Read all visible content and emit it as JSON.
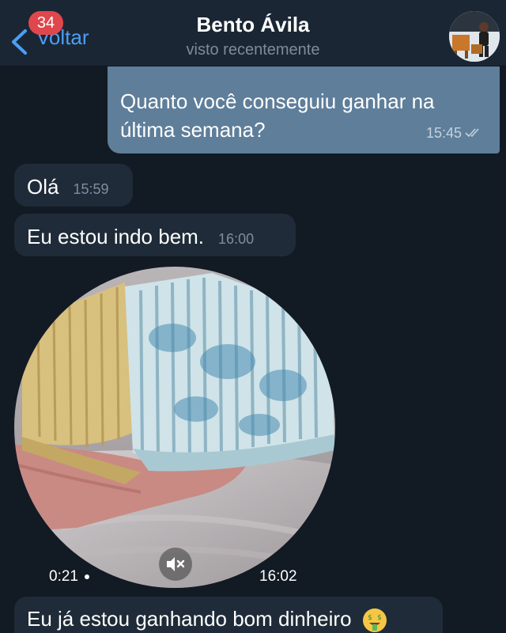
{
  "header": {
    "back_label": "Voltar",
    "unread_badge": "34",
    "contact_name": "Bento Ávila",
    "status": "visto recentemente",
    "avatar_icon": "profile-photo"
  },
  "messages": {
    "outgoing_1": {
      "text_line1": "Quanto você conseguiu ganhar na",
      "text_line2": "última semana?",
      "time": "15:45",
      "status_icon": "double-check-icon"
    },
    "incoming_1": {
      "text": "Olá",
      "time": "15:59"
    },
    "incoming_2": {
      "text": "Eu estou indo bem.",
      "time": "16:00"
    },
    "video": {
      "duration": "0:21",
      "time": "16:02",
      "muted_icon": "speaker-muted-icon"
    },
    "incoming_3": {
      "text": "Eu já estou ganhando bom dinheiro",
      "emoji": "money-mouth-face"
    }
  },
  "colors": {
    "background": "#121a24",
    "header": "#1b2634",
    "outgoing_bubble": "#5e7e9a",
    "incoming_bubble": "#1f2b38",
    "accent": "#4a9ff5",
    "badge": "#e0474c"
  }
}
